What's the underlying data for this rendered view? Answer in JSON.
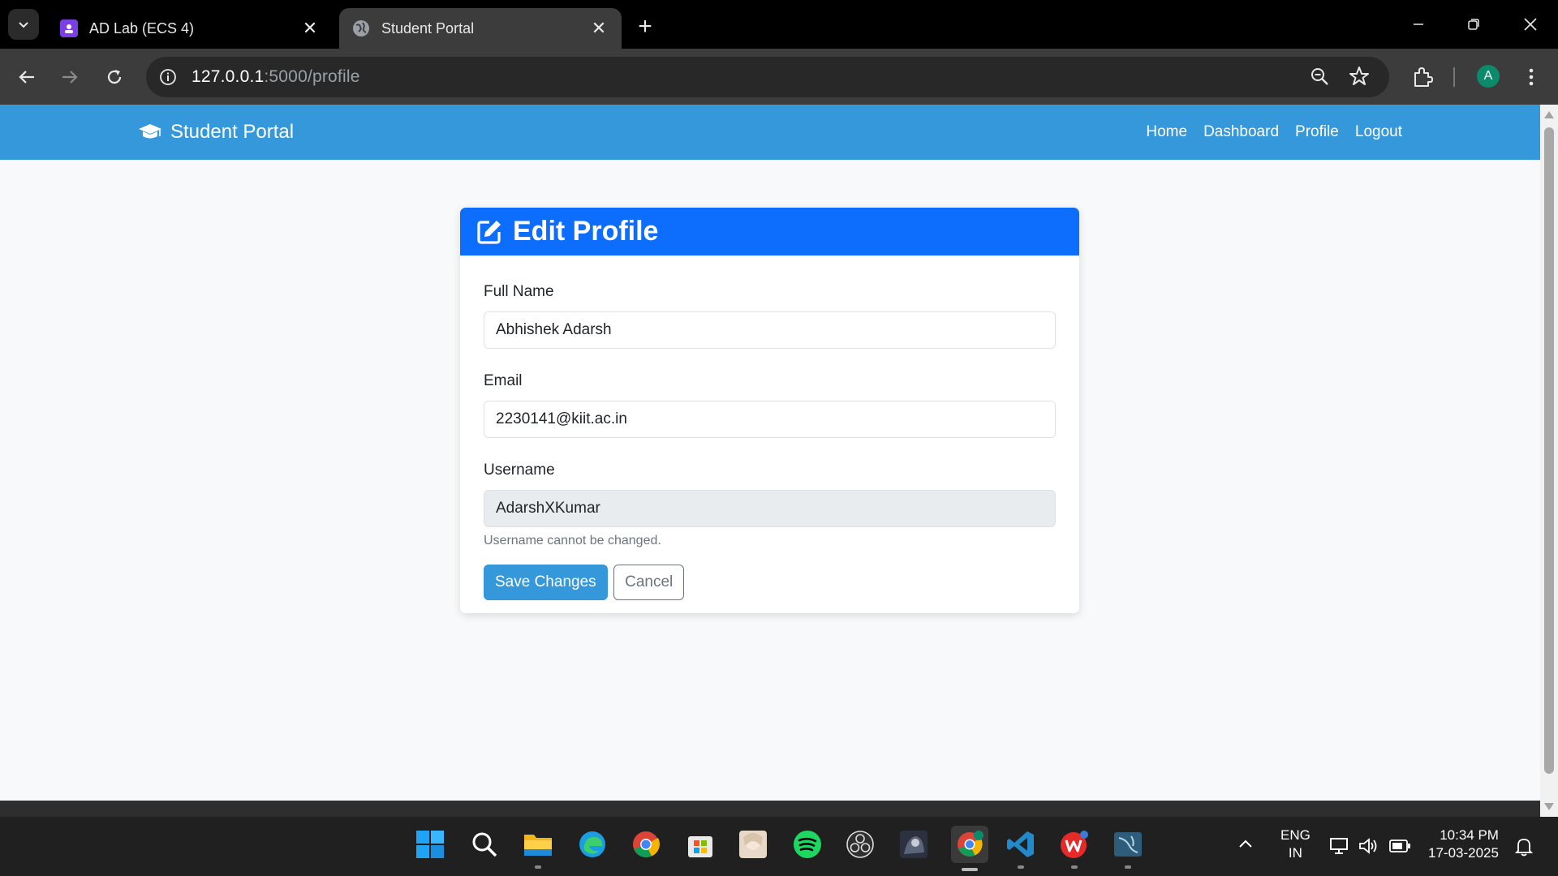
{
  "browser": {
    "tabs": [
      {
        "title": "AD Lab (ECS 4)",
        "active": false,
        "favicon": "classroom-icon"
      },
      {
        "title": "Student Portal",
        "active": true,
        "favicon": "globe-icon"
      }
    ],
    "url_host": "127.0.0.1",
    "url_path": ":5000/profile",
    "profile_initial": "A"
  },
  "navbar": {
    "brand": "Student Portal",
    "links": [
      "Home",
      "Dashboard",
      "Profile",
      "Logout"
    ],
    "color": "#3498db"
  },
  "form": {
    "title": "Edit Profile",
    "header_color": "#0d6efd",
    "fields": [
      {
        "label": "Full Name",
        "value": "Abhishek Adarsh",
        "disabled": false
      },
      {
        "label": "Email",
        "value": "2230141@kiit.ac.in",
        "disabled": false
      },
      {
        "label": "Username",
        "value": "AdarshXKumar",
        "disabled": true
      }
    ],
    "username_help": "Username cannot be changed.",
    "save_label": "Save Changes",
    "cancel_label": "Cancel"
  },
  "taskbar": {
    "language": "ENG",
    "region": "IN",
    "time": "10:34 PM",
    "date": "17-03-2025"
  }
}
